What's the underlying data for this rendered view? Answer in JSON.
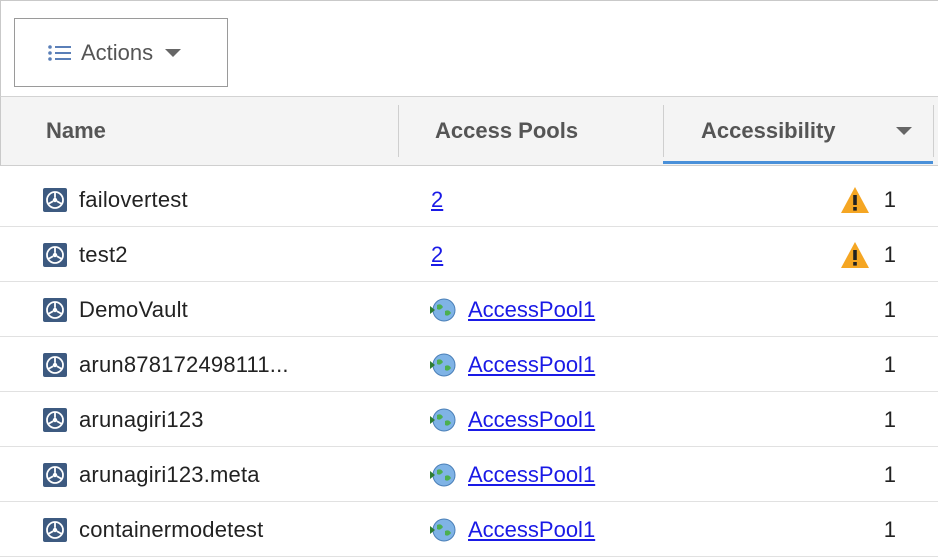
{
  "toolbar": {
    "actions_label": "Actions"
  },
  "table": {
    "columns": {
      "name": "Name",
      "access_pools": "Access Pools",
      "accessibility": "Accessibility"
    },
    "rows": [
      {
        "name": "failovertest",
        "pool_text": "2",
        "pool_kind": "count",
        "warning": true,
        "accessibility": "1"
      },
      {
        "name": "test2",
        "pool_text": "2",
        "pool_kind": "count",
        "warning": true,
        "accessibility": "1"
      },
      {
        "name": "DemoVault",
        "pool_text": "AccessPool1",
        "pool_kind": "pool",
        "warning": false,
        "accessibility": "1"
      },
      {
        "name": "arun878172498111...",
        "pool_text": "AccessPool1",
        "pool_kind": "pool",
        "warning": false,
        "accessibility": "1"
      },
      {
        "name": "arunagiri123",
        "pool_text": "AccessPool1",
        "pool_kind": "pool",
        "warning": false,
        "accessibility": "1"
      },
      {
        "name": "arunagiri123.meta",
        "pool_text": "AccessPool1",
        "pool_kind": "pool",
        "warning": false,
        "accessibility": "1"
      },
      {
        "name": "containermodetest",
        "pool_text": "AccessPool1",
        "pool_kind": "pool",
        "warning": false,
        "accessibility": "1"
      }
    ]
  },
  "colors": {
    "link": "#1a1ae6",
    "sort_indicator": "#4a90d9",
    "warning": "#f5a623",
    "vault_icon": "#3d5a80"
  },
  "icons": {
    "actions": "list-icon",
    "vault": "vault-icon",
    "pool": "globe-icon",
    "warning": "warning-icon"
  }
}
